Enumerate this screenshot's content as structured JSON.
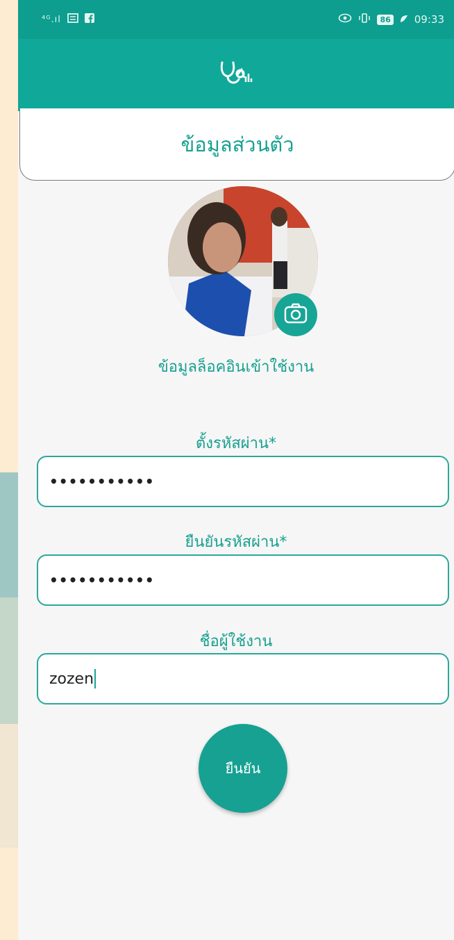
{
  "status_bar": {
    "signal": "⁴ᴳ.ıl",
    "time": "09:33",
    "battery": "86"
  },
  "app_bar": {
    "logo_icon": "stethoscope-icon"
  },
  "header": {
    "title": "ข้อมูลส่วนตัว"
  },
  "profile": {
    "camera_icon": "camera-icon"
  },
  "section": {
    "login_label": "ข้อมูลล็อคอินเข้าใช้งาน"
  },
  "form": {
    "password_label": "ตั้งรหัสผ่าน*",
    "password_value": "•••••••••••",
    "confirm_password_label": "ยืนยันรหัสผ่าน*",
    "confirm_password_value": "•••••••••••",
    "username_label": "ชื่อผู้ใช้งาน",
    "username_value": "zozen"
  },
  "actions": {
    "confirm_label": "ยืนยัน"
  },
  "colors": {
    "primary": "#10a899",
    "accent": "#17a090"
  }
}
